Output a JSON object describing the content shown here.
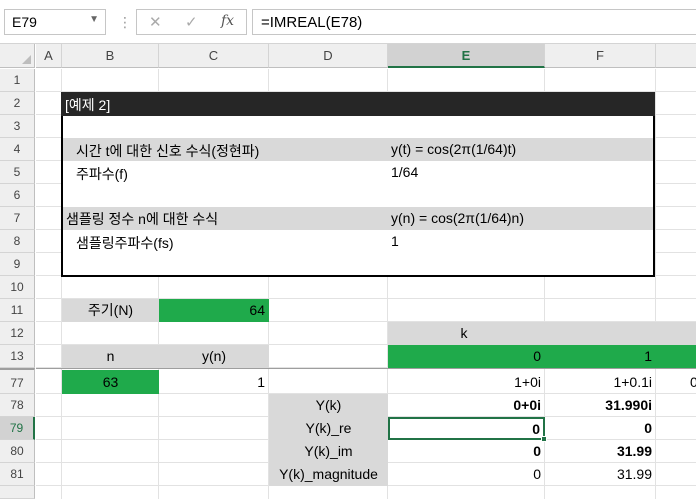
{
  "formula_bar": {
    "name_box": "E79",
    "cancel_icon": "✕",
    "enter_icon": "✓",
    "fx_label": "fx",
    "formula": "=IMREAL(E78)"
  },
  "columns": [
    "A",
    "B",
    "C",
    "D",
    "E",
    "F"
  ],
  "rows": [
    "1",
    "2",
    "3",
    "4",
    "5",
    "6",
    "7",
    "8",
    "9",
    "10",
    "11",
    "12",
    "13",
    "77",
    "78",
    "79",
    "80",
    "81"
  ],
  "selected_cell": {
    "column": "E",
    "row": "79"
  },
  "cells": {
    "title": "[예제 2]",
    "b4": "시간 t에 대한 신호 수식(정현파)",
    "e4": "y(t) = cos(2π(1/64)t)",
    "b5": "주파수(f)",
    "e5": "1/64",
    "b7": "샘플링 정수 n에 대한 수식",
    "e7": "y(n) = cos(2π(1/64)n)",
    "b8": "샘플링주파수(fs)",
    "e8": "1",
    "b11": "주기(N)",
    "c11": "64",
    "k_header": "k",
    "e13": "0",
    "f13": "1",
    "b13": "n",
    "c13": "y(n)",
    "b77": "63",
    "c77": "1",
    "e77": "1+0i",
    "f77": "1+0.1i",
    "g77_partial": "0",
    "d78": "Y(k)",
    "e78": "0+0i",
    "f78": "31.990i",
    "d79": "Y(k)_re",
    "e79": "0",
    "f79": "0",
    "d80": "Y(k)_im",
    "e80": "0",
    "f80": "31.99",
    "d81": "Y(k)_magnitude",
    "e81": "0",
    "f81": "31.99"
  },
  "colors": {
    "green": "#1faa4b",
    "gray": "#d9d9d9",
    "title_bar": "#262626",
    "excel_green": "#217346"
  }
}
